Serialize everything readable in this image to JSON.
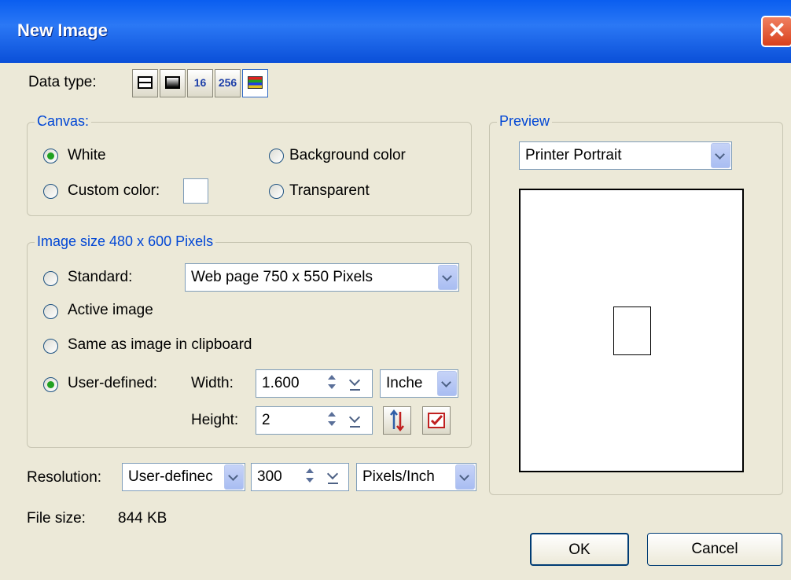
{
  "window": {
    "title": "New Image",
    "close_glyph": "✕"
  },
  "data_type": {
    "label": "Data type:",
    "buttons": [
      {
        "name": "black-white-icon"
      },
      {
        "name": "greyscale-icon"
      },
      {
        "name": "16-colors",
        "label": "16"
      },
      {
        "name": "256-colors",
        "label": "256"
      },
      {
        "name": "true-color-icon",
        "selected": true
      }
    ]
  },
  "canvas": {
    "group_title": "Canvas:",
    "options": {
      "white": "White",
      "background": "Background color",
      "custom": "Custom color:",
      "transparent": "Transparent"
    },
    "selected": "white",
    "custom_color": "#ffffff"
  },
  "image_size": {
    "group_title": "Image size 480 x 600 Pixels",
    "standard_label": "Standard:",
    "standard_value": "Web page 750 x 550 Pixels",
    "active_label": "Active image",
    "clipboard_label": "Same as image in clipboard",
    "user_defined_label": "User-defined:",
    "selected": "user-defined",
    "width_label": "Width:",
    "width_value": "1.600",
    "height_label": "Height:",
    "height_value": "2",
    "unit_value": "Inche"
  },
  "resolution": {
    "label": "Resolution:",
    "mode_value": "User-definec",
    "value": "300",
    "unit_value": "Pixels/Inch"
  },
  "file_size": {
    "label": "File size:",
    "value": "844 KB"
  },
  "preview": {
    "group_title": "Preview",
    "mode_value": "Printer Portrait"
  },
  "buttons": {
    "ok": "OK",
    "cancel": "Cancel"
  },
  "colors": {
    "accent": "#0046d5",
    "titlebar": "#0a5ef0",
    "dialog_bg": "#ece9d8",
    "radio_selected": "#21a121"
  }
}
